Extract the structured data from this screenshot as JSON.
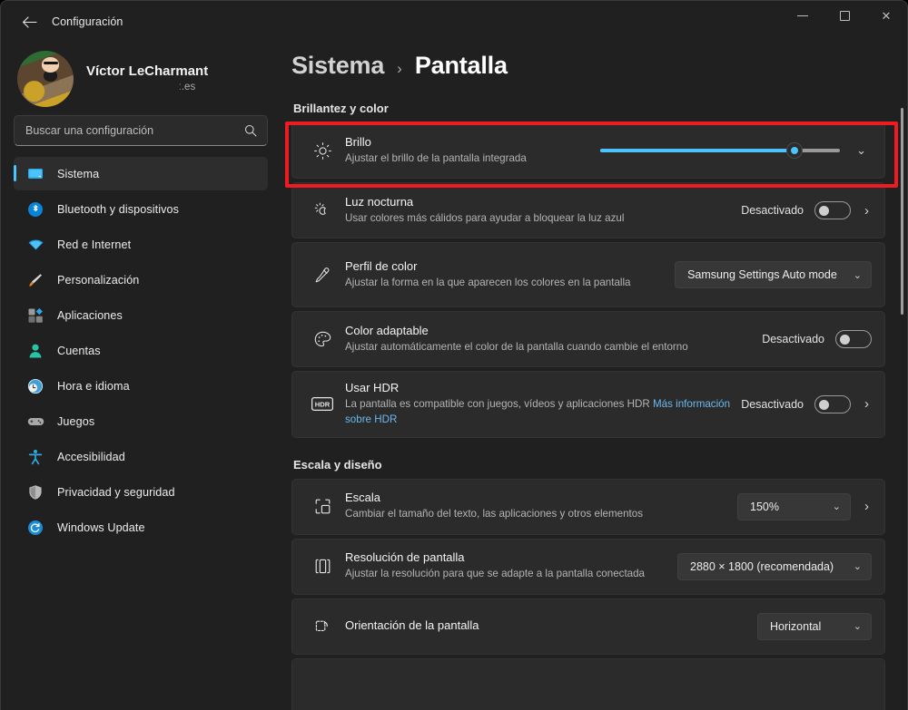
{
  "window": {
    "app_title": "Configuración",
    "back_icon": "arrow-left-icon",
    "minimize_label": "Minimizar",
    "maximize_label": "Maximizar",
    "close_label": "Cerrar"
  },
  "account": {
    "name": "Víctor LeCharmant",
    "email": "ː.es"
  },
  "search": {
    "placeholder": "Buscar una configuración",
    "value": "",
    "icon": "search-icon"
  },
  "sidebar": {
    "items": [
      {
        "label": "Sistema",
        "icon": "monitor-icon",
        "active": true
      },
      {
        "label": "Bluetooth y dispositivos",
        "icon": "bluetooth-icon",
        "active": false
      },
      {
        "label": "Red e Internet",
        "icon": "wifi-icon",
        "active": false
      },
      {
        "label": "Personalización",
        "icon": "paintbrush-icon",
        "active": false
      },
      {
        "label": "Aplicaciones",
        "icon": "apps-icon",
        "active": false
      },
      {
        "label": "Cuentas",
        "icon": "person-icon",
        "active": false
      },
      {
        "label": "Hora e idioma",
        "icon": "clock-globe-icon",
        "active": false
      },
      {
        "label": "Juegos",
        "icon": "gamepad-icon",
        "active": false
      },
      {
        "label": "Accesibilidad",
        "icon": "accessibility-icon",
        "active": false
      },
      {
        "label": "Privacidad y seguridad",
        "icon": "shield-icon",
        "active": false
      },
      {
        "label": "Windows Update",
        "icon": "update-icon",
        "active": false
      }
    ]
  },
  "breadcrumb": {
    "root": "Sistema",
    "separator": "›",
    "leaf": "Pantalla"
  },
  "sections": {
    "brightness": {
      "title": "Brillantez y color",
      "rows": {
        "brillo": {
          "title": "Brillo",
          "desc": "Ajustar el brillo de la pantalla integrada",
          "icon": "brightness-icon",
          "slider_percent": 81,
          "expand_icon": "chevron-down-icon"
        },
        "luz_nocturna": {
          "title": "Luz nocturna",
          "desc": "Usar colores más cálidos para ayudar a bloquear la luz azul",
          "icon": "night-light-icon",
          "status": "Desactivado",
          "toggle_on": false,
          "chevron_icon": "chevron-right-icon"
        },
        "perfil_color": {
          "title": "Perfil de color",
          "desc": "Ajustar la forma en la que aparecen los colores en la pantalla",
          "icon": "eyedropper-icon",
          "dropdown_value": "Samsung Settings Auto mode",
          "dropdown_icon": "chevron-down-icon"
        },
        "color_adaptable": {
          "title": "Color adaptable",
          "desc": "Ajustar automáticamente el color de la pantalla cuando cambie el entorno",
          "icon": "palette-icon",
          "status": "Desactivado",
          "toggle_on": false
        },
        "usar_hdr": {
          "title": "Usar HDR",
          "desc": "La pantalla es compatible con juegos, vídeos y aplicaciones HDR",
          "link": "Más información sobre HDR",
          "icon": "hdr-icon",
          "status": "Desactivado",
          "toggle_on": false,
          "chevron_icon": "chevron-right-icon"
        }
      }
    },
    "scale": {
      "title": "Escala y diseño",
      "rows": {
        "escala": {
          "title": "Escala",
          "desc": "Cambiar el tamaño del texto, las aplicaciones y otros elementos",
          "icon": "scale-icon",
          "dropdown_value": "150%",
          "dropdown_icon": "chevron-down-icon",
          "chevron_icon": "chevron-right-icon"
        },
        "resolucion": {
          "title": "Resolución de pantalla",
          "desc": "Ajustar la resolución para que se adapte a la pantalla conectada",
          "icon": "resolution-icon",
          "dropdown_value": "2880 × 1800 (recomendada)",
          "dropdown_icon": "chevron-down-icon"
        },
        "orientacion": {
          "title": "Orientación de la pantalla",
          "desc": "",
          "icon": "orientation-icon",
          "dropdown_value": "Horizontal",
          "dropdown_icon": "chevron-down-icon"
        }
      }
    }
  },
  "colors": {
    "accent": "#4cc2ff",
    "highlight_box": "#ee1c22",
    "link": "#6cb8ef",
    "page_bg": "#202020",
    "card_bg": "#2b2b2b"
  }
}
